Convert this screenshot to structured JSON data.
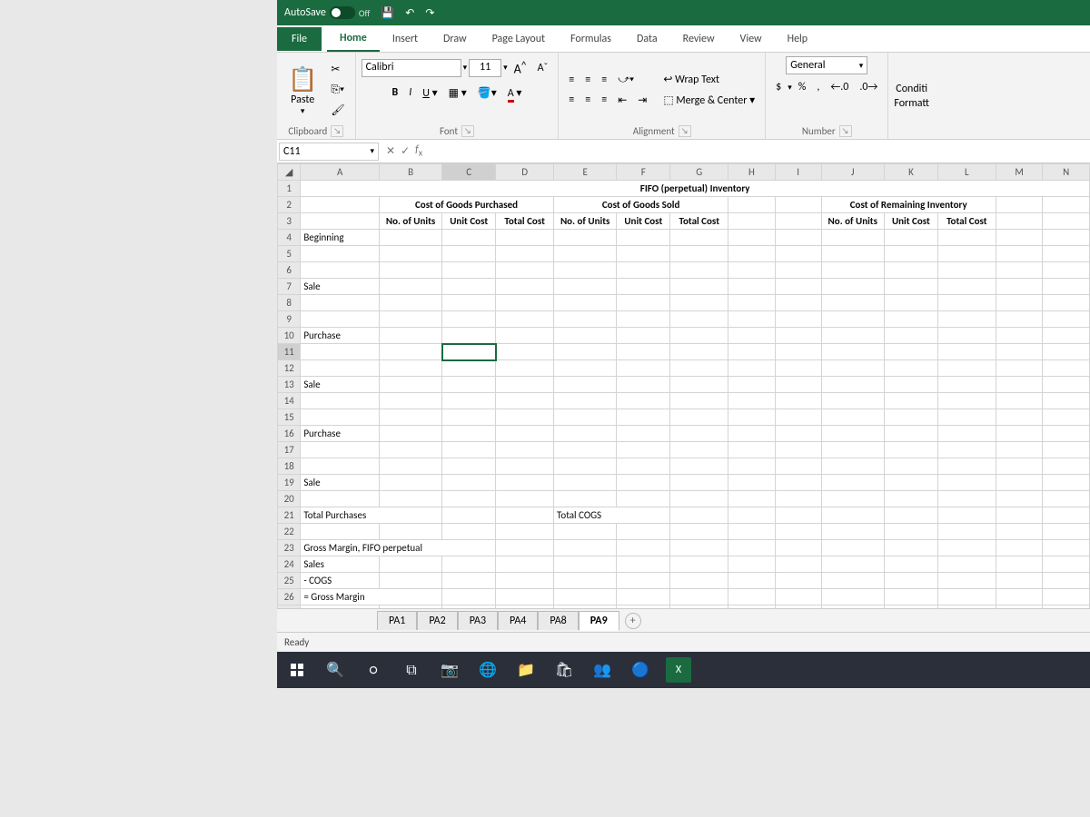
{
  "titlebar": {
    "autosave": "AutoSave",
    "autosave_state": "Off"
  },
  "tabs": {
    "file": "File",
    "home": "Home",
    "insert": "Insert",
    "draw": "Draw",
    "pagelayout": "Page Layout",
    "formulas": "Formulas",
    "data": "Data",
    "review": "Review",
    "view": "View",
    "help": "Help"
  },
  "ribbon": {
    "paste": "Paste",
    "clipboard": "Clipboard",
    "font_name": "Calibri",
    "font_size": "11",
    "bold": "B",
    "italic": "I",
    "underline": "U",
    "grow": "A",
    "shrink": "A",
    "font": "Font",
    "wrap": "Wrap Text",
    "merge": "Merge & Center",
    "alignment": "Alignment",
    "numformat": "General",
    "number": "Number",
    "currency": "$",
    "percent": "%",
    "comma": ",",
    "incdec": ".00",
    "decdec": ".00",
    "cond": "Conditi",
    "formatt": "Formatt"
  },
  "namebox": "C11",
  "columns": [
    "A",
    "B",
    "C",
    "D",
    "E",
    "F",
    "G",
    "H",
    "I",
    "J",
    "K",
    "L",
    "M",
    "N"
  ],
  "rows": {
    "1": {
      "title": "FIFO (perpetual) Inventory"
    },
    "2": {
      "bcd": "Cost of Goods Purchased",
      "efg": "Cost of Goods Sold",
      "jkl": "Cost of Remaining Inventory"
    },
    "3": {
      "b": "No. of Units",
      "c": "Unit Cost",
      "d": "Total Cost",
      "e": "No. of Units",
      "f": "Unit Cost",
      "g": "Total Cost",
      "j": "No. of Units",
      "k": "Unit Cost",
      "l": "Total Cost"
    },
    "4": {
      "a": "Beginning"
    },
    "7": {
      "a": "Sale"
    },
    "10": {
      "a": "Purchase"
    },
    "13": {
      "a": "Sale"
    },
    "16": {
      "a": "Purchase"
    },
    "19": {
      "a": "Sale"
    },
    "21": {
      "a": "Total Purchases",
      "e": "Total COGS"
    },
    "23": {
      "a": "Gross Margin, FIFO perpetual"
    },
    "24": {
      "a": "Sales"
    },
    "25": {
      "a": "- COGS"
    },
    "26": {
      "a": "= Gross Margin"
    }
  },
  "sheets": {
    "s1": "PA1",
    "s2": "PA2",
    "s3": "PA3",
    "s4": "PA4",
    "s8": "PA8",
    "s9": "PA9"
  },
  "status": "Ready"
}
